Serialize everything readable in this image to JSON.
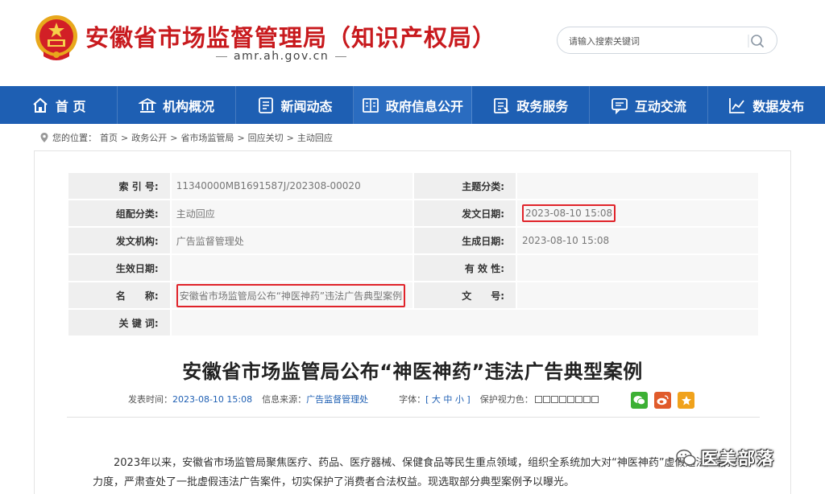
{
  "header": {
    "title": "安徽省市场监督管理局（知识产权局）",
    "domain": "amr.ah.gov.cn",
    "search_placeholder": "请输入搜索关键词"
  },
  "nav": {
    "items": [
      {
        "label": "首 页",
        "icon": "home-icon"
      },
      {
        "label": "机构概况",
        "icon": "institution-icon"
      },
      {
        "label": "新闻动态",
        "icon": "news-icon"
      },
      {
        "label": "政府信息公开",
        "icon": "open-book-icon"
      },
      {
        "label": "政务服务",
        "icon": "clipboard-icon"
      },
      {
        "label": "互动交流",
        "icon": "chat-icon"
      },
      {
        "label": "数据发布",
        "icon": "line-chart-icon"
      }
    ]
  },
  "breadcrumb": {
    "prefix": "您的位置：",
    "items": [
      "首页",
      "政务公开",
      "省市场监管局",
      "回应关切",
      "主动回应"
    ],
    "separator": ">"
  },
  "info": {
    "index_label": "索 引 号:",
    "index_value": "11340000MB1691587J/202308-00020",
    "topic_label": "主题分类:",
    "topic_value": "",
    "category_label": "组配分类:",
    "category_value": "主动回应",
    "issue_date_label": "发文日期:",
    "issue_date_value": "2023-08-10 15:08",
    "issuer_label": "发文机构:",
    "issuer_value": "广告监督管理处",
    "created_date_label": "生成日期:",
    "created_date_value": "2023-08-10 15:08",
    "effective_date_label": "生效日期:",
    "effective_date_value": "",
    "validity_label": "有 效 性:",
    "validity_value": "",
    "name_label": "名　　称:",
    "name_value": "安徽省市场监管局公布“神医神药”违法广告典型案例",
    "doc_number_label": "文　　号:",
    "doc_number_value": "",
    "keywords_label": "关 键 词:",
    "keywords_value": ""
  },
  "article": {
    "title": "安徽省市场监管局公布“神医神药”违法广告典型案例",
    "publish_time_label": "发表时间：",
    "publish_time": "2023-08-10 15:08",
    "source_label": "信息来源：",
    "source": "广告监督管理处",
    "font_label": "字体：",
    "font_size_options": "[ 大 中 小 ]",
    "vision_label": "保护视力色：",
    "paragraph": "2023年以来，安徽省市场监管局聚焦医疗、药品、医疗器械、保健食品等民生重点领域，组织全系统加大对“神医神药”虚假违法广告打击力度，严肃查处了一批虚假违法广告案件，切实保护了消费者合法权益。现选取部分典型案例予以曝光。"
  },
  "watermark": {
    "text": "医美部落"
  },
  "colors": {
    "brand_red": "#c81a1e",
    "nav_blue": "#1e5fb3",
    "highlight_red": "#e0232a"
  }
}
